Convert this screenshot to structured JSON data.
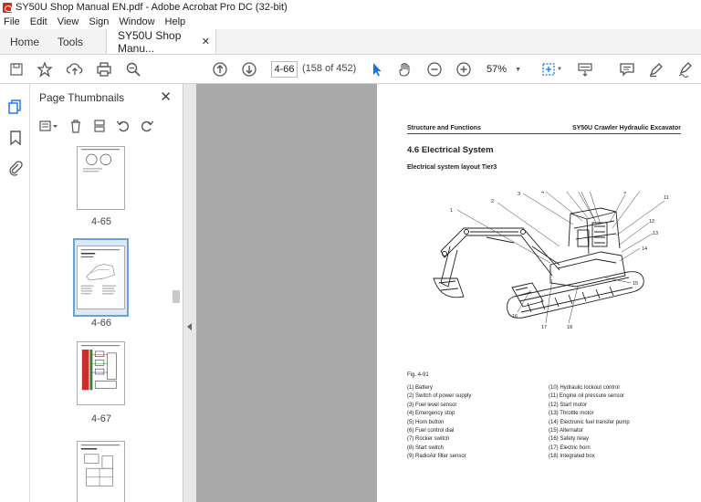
{
  "window": {
    "title": "SY50U Shop Manual EN.pdf - Adobe Acrobat Pro DC (32-bit)"
  },
  "menu": [
    "File",
    "Edit",
    "View",
    "Sign",
    "Window",
    "Help"
  ],
  "tabs": {
    "home": "Home",
    "tools": "Tools",
    "document": "SY50U Shop Manu..."
  },
  "toolbar": {
    "page_number": "4-66",
    "page_count": "(158 of 452)",
    "zoom": "57%"
  },
  "thumbnails": {
    "title": "Page Thumbnails",
    "items": [
      {
        "label": "4-65",
        "selected": false
      },
      {
        "label": "4-66",
        "selected": true
      },
      {
        "label": "4-67",
        "selected": false
      },
      {
        "label": "",
        "selected": false
      }
    ]
  },
  "pdf": {
    "header_left": "Structure and Functions",
    "header_right": "SY50U Crawler Hydraulic Excavator",
    "section_title": "4.6 Electrical System",
    "subtitle": "Electrical system layout Tier3",
    "figure_caption": "Fig. 4-91",
    "callouts": [
      "1",
      "2",
      "3",
      "4",
      "5",
      "6",
      "7",
      "8",
      "9",
      "10",
      "11",
      "12",
      "13",
      "14",
      "15",
      "16",
      "17",
      "18"
    ],
    "legend_left": [
      "(1) Battery",
      "(2) Switch of power supply",
      "(3) Fuel level sensor",
      "(4) Emergency stop",
      "(5) Horn button",
      "(6) Fuel control dial",
      "(7) Rocker switch",
      "(8) Start switch",
      "(9) RadioAir filter sensor"
    ],
    "legend_right": [
      "(10) Hydraulic lockout control",
      "(11) Engine oil pressure sensor",
      "(12) Start motor",
      "(13) Throttle motor",
      "(14) Electronic fuel transfer pump",
      "(15) Alternator",
      "(16) Safety relay",
      "(17) Electric horn",
      "(18) Integrated box"
    ]
  }
}
